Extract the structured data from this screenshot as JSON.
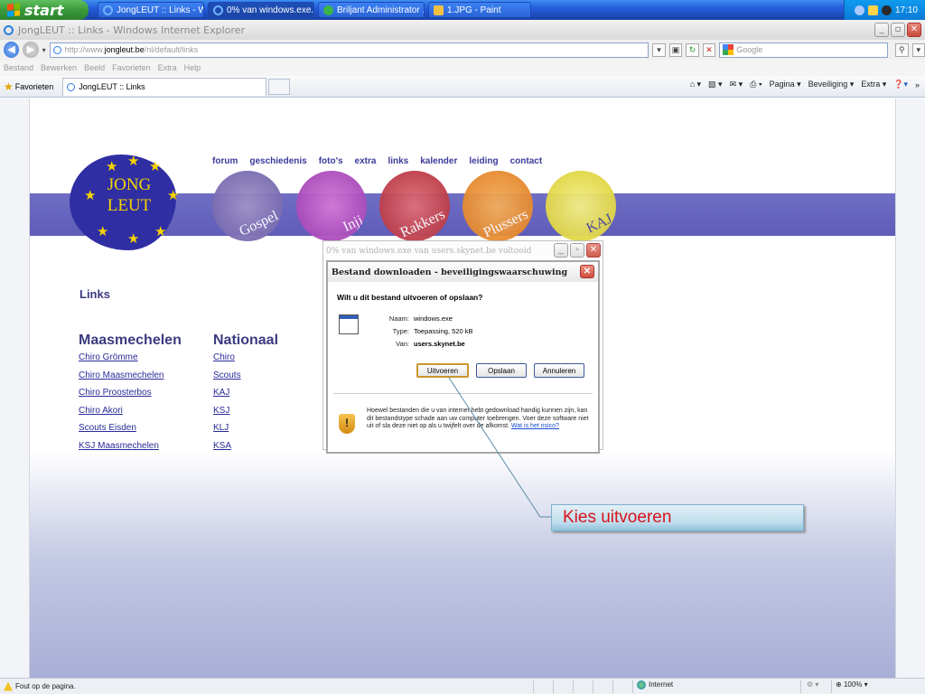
{
  "taskbar": {
    "start": "start",
    "tasks": [
      {
        "label": "JongLEUT :: Links - W..."
      },
      {
        "label": "0% van windows.exe..."
      },
      {
        "label": "Briljant Administrator ..."
      },
      {
        "label": "1.JPG - Paint"
      }
    ],
    "clock": "17:10"
  },
  "window": {
    "title": "JongLEUT :: Links - Windows Internet Explorer"
  },
  "address": {
    "url_prefix": "http://www.",
    "url_domain": "jongleut.be",
    "url_path": "/nl/default/links",
    "search_placeholder": "Google"
  },
  "menu": [
    "Bestand",
    "Bewerken",
    "Beeld",
    "Favorieten",
    "Extra",
    "Help"
  ],
  "favorites": {
    "label": "Favorieten",
    "tab_title": "JongLEUT :: Links",
    "commands": [
      "Pagina ▾",
      "Beveiliging ▾",
      "Extra ▾"
    ]
  },
  "site": {
    "logo_line1": "JONG",
    "logo_line2": "LEUT",
    "nav": [
      "forum",
      "geschiedenis",
      "foto's",
      "extra",
      "links",
      "kalender",
      "leiding",
      "contact"
    ],
    "circles": [
      "Gospel",
      "Inji",
      "Rakkers",
      "Plussers",
      "KAJ"
    ],
    "links_heading": "Links",
    "columns": [
      {
        "heading": "Maasmechelen",
        "items": [
          "Chiro Grömme",
          "Chiro Maasmechelen",
          "Chiro Proosterbos",
          "Chiro Akori",
          "Scouts Eisden",
          "KSJ Maasmechelen"
        ]
      },
      {
        "heading": "Nationaal",
        "items": [
          "Chiro",
          "Scouts",
          "KAJ",
          "KSJ",
          "KLJ",
          "KSA"
        ]
      }
    ]
  },
  "progress_dialog": {
    "title": "0% van windows.exe van users.skynet.be voltooid"
  },
  "download_dialog": {
    "title": "Bestand downloaden - beveiligingswaarschuwing",
    "question": "Wilt u dit bestand uitvoeren of opslaan?",
    "name_label": "Naam:",
    "name_value": "windows.exe",
    "type_label": "Type:",
    "type_value": "Toepassing, 520 kB",
    "from_label": "Van:",
    "from_value": "users.skynet.be",
    "run_button": "Uitvoeren",
    "save_button": "Opslaan",
    "cancel_button": "Annuleren",
    "warning": "Hoewel bestanden die u van internet hebt gedownload handig kunnen zijn, kan dit bestandstype schade aan uw computer toebrengen. Voer deze software niet uit of sla deze niet op als u twijfelt over de afkomst.",
    "warning_link": "Wat is het risico?"
  },
  "callout": {
    "text": "Kies uitvoeren"
  },
  "status": {
    "message": "Fout op de pagina.",
    "zone": "Internet",
    "zoom": "100%"
  }
}
